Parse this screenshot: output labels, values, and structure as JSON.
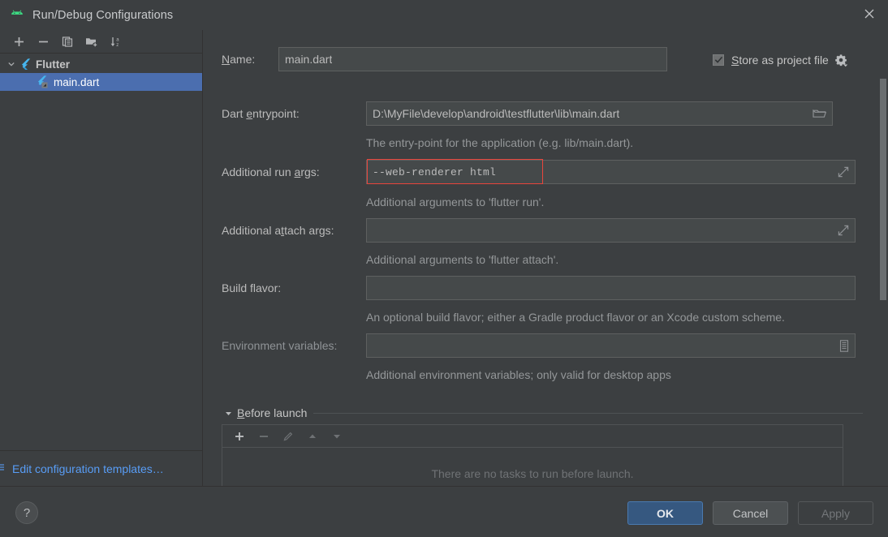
{
  "window": {
    "title": "Run/Debug Configurations",
    "app_icon": "android-icon",
    "close_icon": "close-icon"
  },
  "left_panel": {
    "toolbar": [
      {
        "name": "add-configuration-button",
        "icon": "plus-icon",
        "label": "+"
      },
      {
        "name": "remove-configuration-button",
        "icon": "minus-icon",
        "label": "−"
      },
      {
        "name": "copy-configuration-button",
        "icon": "copy-icon",
        "label": ""
      },
      {
        "name": "new-folder-button",
        "icon": "folder-add-icon",
        "label": ""
      },
      {
        "name": "sort-configurations-button",
        "icon": "sort-az-icon",
        "label": ""
      }
    ],
    "tree": [
      {
        "name": "tree-group-flutter",
        "label": "Flutter",
        "icon": "flutter-icon",
        "expanded": true,
        "selected": false
      },
      {
        "name": "tree-item-main-dart",
        "label": "main.dart",
        "icon": "flutter-icon",
        "selected": true
      }
    ],
    "edit_templates_link": "Edit configuration templates…"
  },
  "form": {
    "name": {
      "label": "Name:",
      "accel": "N",
      "value": "main.dart"
    },
    "store_as_project_file": {
      "label": "Store as project file",
      "accel": "S",
      "checked": true,
      "gear_icon": "gear-dropdown-icon"
    },
    "dart_entrypoint": {
      "label": "Dart entrypoint:",
      "accel": "e",
      "value": "D:\\MyFile\\develop\\android\\testflutter\\lib\\main.dart",
      "browse_icon": "folder-icon",
      "hint": "The entry-point for the application (e.g. lib/main.dart)."
    },
    "additional_run_args": {
      "label": "Additional run args:",
      "accel": "a",
      "value": "--web-renderer html",
      "expand_icon": "expand-icon",
      "hint": "Additional arguments to 'flutter run'.",
      "highlight_color": "#e8453c"
    },
    "additional_attach_args": {
      "label": "Additional attach args:",
      "accel": "t",
      "value": "",
      "expand_icon": "expand-icon",
      "hint": "Additional arguments to 'flutter attach'."
    },
    "build_flavor": {
      "label": "Build flavor:",
      "value": "",
      "hint": "An optional build flavor; either a Gradle product flavor or an Xcode custom scheme."
    },
    "environment_variables": {
      "label": "Environment variables:",
      "value": "",
      "list_icon": "edit-list-icon",
      "hint": "Additional environment variables; only valid for desktop apps"
    }
  },
  "before_launch": {
    "title": "Before launch",
    "accel": "B",
    "expanded": true,
    "toolbar": [
      {
        "name": "add-task-button",
        "icon": "plus-icon",
        "enabled": true
      },
      {
        "name": "remove-task-button",
        "icon": "minus-icon",
        "enabled": false
      },
      {
        "name": "edit-task-button",
        "icon": "pencil-icon",
        "enabled": false
      },
      {
        "name": "move-task-up-button",
        "icon": "arrow-up-icon",
        "enabled": false
      },
      {
        "name": "move-task-down-button",
        "icon": "arrow-down-icon",
        "enabled": false
      }
    ],
    "empty_text": "There are no tasks to run before launch."
  },
  "footer": {
    "help_label": "?",
    "ok_label": "OK",
    "cancel_label": "Cancel",
    "apply_label": "Apply"
  },
  "colors": {
    "background": "#3c3f41",
    "field_background": "#45494a",
    "selection": "#4b6eaf",
    "accent_blue": "#589df6",
    "ok_button": "#365880",
    "error_red": "#e8453c",
    "flutter_blue": "#42a5f5"
  }
}
